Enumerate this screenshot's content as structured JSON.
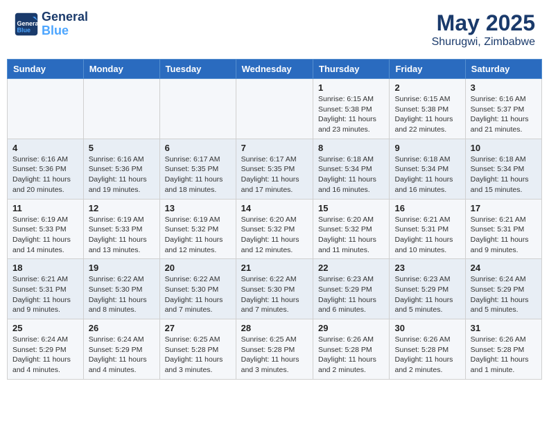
{
  "header": {
    "logo_line1": "General",
    "logo_line2": "Blue",
    "title": "May 2025",
    "subtitle": "Shurugwi, Zimbabwe"
  },
  "weekdays": [
    "Sunday",
    "Monday",
    "Tuesday",
    "Wednesday",
    "Thursday",
    "Friday",
    "Saturday"
  ],
  "weeks": [
    [
      {
        "day": "",
        "content": ""
      },
      {
        "day": "",
        "content": ""
      },
      {
        "day": "",
        "content": ""
      },
      {
        "day": "",
        "content": ""
      },
      {
        "day": "1",
        "content": "Sunrise: 6:15 AM\nSunset: 5:38 PM\nDaylight: 11 hours and 23 minutes."
      },
      {
        "day": "2",
        "content": "Sunrise: 6:15 AM\nSunset: 5:38 PM\nDaylight: 11 hours and 22 minutes."
      },
      {
        "day": "3",
        "content": "Sunrise: 6:16 AM\nSunset: 5:37 PM\nDaylight: 11 hours and 21 minutes."
      }
    ],
    [
      {
        "day": "4",
        "content": "Sunrise: 6:16 AM\nSunset: 5:36 PM\nDaylight: 11 hours and 20 minutes."
      },
      {
        "day": "5",
        "content": "Sunrise: 6:16 AM\nSunset: 5:36 PM\nDaylight: 11 hours and 19 minutes."
      },
      {
        "day": "6",
        "content": "Sunrise: 6:17 AM\nSunset: 5:35 PM\nDaylight: 11 hours and 18 minutes."
      },
      {
        "day": "7",
        "content": "Sunrise: 6:17 AM\nSunset: 5:35 PM\nDaylight: 11 hours and 17 minutes."
      },
      {
        "day": "8",
        "content": "Sunrise: 6:18 AM\nSunset: 5:34 PM\nDaylight: 11 hours and 16 minutes."
      },
      {
        "day": "9",
        "content": "Sunrise: 6:18 AM\nSunset: 5:34 PM\nDaylight: 11 hours and 16 minutes."
      },
      {
        "day": "10",
        "content": "Sunrise: 6:18 AM\nSunset: 5:34 PM\nDaylight: 11 hours and 15 minutes."
      }
    ],
    [
      {
        "day": "11",
        "content": "Sunrise: 6:19 AM\nSunset: 5:33 PM\nDaylight: 11 hours and 14 minutes."
      },
      {
        "day": "12",
        "content": "Sunrise: 6:19 AM\nSunset: 5:33 PM\nDaylight: 11 hours and 13 minutes."
      },
      {
        "day": "13",
        "content": "Sunrise: 6:19 AM\nSunset: 5:32 PM\nDaylight: 11 hours and 12 minutes."
      },
      {
        "day": "14",
        "content": "Sunrise: 6:20 AM\nSunset: 5:32 PM\nDaylight: 11 hours and 12 minutes."
      },
      {
        "day": "15",
        "content": "Sunrise: 6:20 AM\nSunset: 5:32 PM\nDaylight: 11 hours and 11 minutes."
      },
      {
        "day": "16",
        "content": "Sunrise: 6:21 AM\nSunset: 5:31 PM\nDaylight: 11 hours and 10 minutes."
      },
      {
        "day": "17",
        "content": "Sunrise: 6:21 AM\nSunset: 5:31 PM\nDaylight: 11 hours and 9 minutes."
      }
    ],
    [
      {
        "day": "18",
        "content": "Sunrise: 6:21 AM\nSunset: 5:31 PM\nDaylight: 11 hours and 9 minutes."
      },
      {
        "day": "19",
        "content": "Sunrise: 6:22 AM\nSunset: 5:30 PM\nDaylight: 11 hours and 8 minutes."
      },
      {
        "day": "20",
        "content": "Sunrise: 6:22 AM\nSunset: 5:30 PM\nDaylight: 11 hours and 7 minutes."
      },
      {
        "day": "21",
        "content": "Sunrise: 6:22 AM\nSunset: 5:30 PM\nDaylight: 11 hours and 7 minutes."
      },
      {
        "day": "22",
        "content": "Sunrise: 6:23 AM\nSunset: 5:29 PM\nDaylight: 11 hours and 6 minutes."
      },
      {
        "day": "23",
        "content": "Sunrise: 6:23 AM\nSunset: 5:29 PM\nDaylight: 11 hours and 5 minutes."
      },
      {
        "day": "24",
        "content": "Sunrise: 6:24 AM\nSunset: 5:29 PM\nDaylight: 11 hours and 5 minutes."
      }
    ],
    [
      {
        "day": "25",
        "content": "Sunrise: 6:24 AM\nSunset: 5:29 PM\nDaylight: 11 hours and 4 minutes."
      },
      {
        "day": "26",
        "content": "Sunrise: 6:24 AM\nSunset: 5:29 PM\nDaylight: 11 hours and 4 minutes."
      },
      {
        "day": "27",
        "content": "Sunrise: 6:25 AM\nSunset: 5:28 PM\nDaylight: 11 hours and 3 minutes."
      },
      {
        "day": "28",
        "content": "Sunrise: 6:25 AM\nSunset: 5:28 PM\nDaylight: 11 hours and 3 minutes."
      },
      {
        "day": "29",
        "content": "Sunrise: 6:26 AM\nSunset: 5:28 PM\nDaylight: 11 hours and 2 minutes."
      },
      {
        "day": "30",
        "content": "Sunrise: 6:26 AM\nSunset: 5:28 PM\nDaylight: 11 hours and 2 minutes."
      },
      {
        "day": "31",
        "content": "Sunrise: 6:26 AM\nSunset: 5:28 PM\nDaylight: 11 hours and 1 minute."
      }
    ]
  ]
}
